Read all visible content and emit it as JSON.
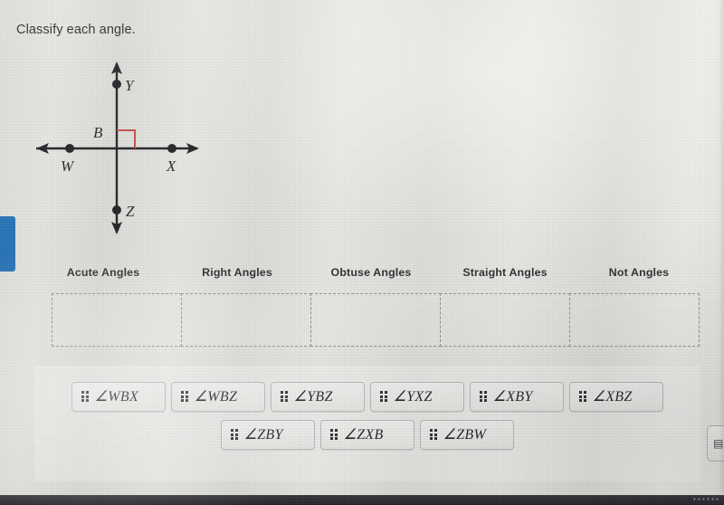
{
  "question": {
    "prompt": "Classify each angle."
  },
  "figure": {
    "labels": {
      "Y": "Y",
      "B": "B",
      "W": "W",
      "X": "X",
      "Z": "Z"
    },
    "right_angle_marker_color": "#c0453f",
    "line_color": "#15151a",
    "description": "Two perpendicular lines intersecting at point B; vertical line through Y (up) and Z (down), horizontal line through W (left) and X (right), with a right-angle square marked in the upper-right quadrant."
  },
  "categories": [
    {
      "label": "Acute Angles"
    },
    {
      "label": "Right Angles"
    },
    {
      "label": "Obtuse Angles"
    },
    {
      "label": "Straight Angles"
    },
    {
      "label": "Not Angles"
    }
  ],
  "tiles": {
    "handle_icon": "drag-handle-icon",
    "row1": [
      {
        "label": "∠WBX"
      },
      {
        "label": "∠WBZ"
      },
      {
        "label": "∠YBZ"
      },
      {
        "label": "∠YXZ"
      },
      {
        "label": "∠XBY"
      },
      {
        "label": "∠XBZ"
      }
    ],
    "row2": [
      {
        "label": "∠ZBY"
      },
      {
        "label": "∠ZXB"
      },
      {
        "label": "∠ZBW"
      }
    ]
  },
  "edge_button": {
    "icon": "calculator-icon",
    "glyph": "▤"
  },
  "bottom_strip": {
    "text": "▪ ▪ ▪ ▪ ▪ ▪"
  },
  "colors": {
    "blue_tab": "#1a6cb4",
    "dashed_border": "#8d8f92",
    "header_text": "#25252a"
  }
}
